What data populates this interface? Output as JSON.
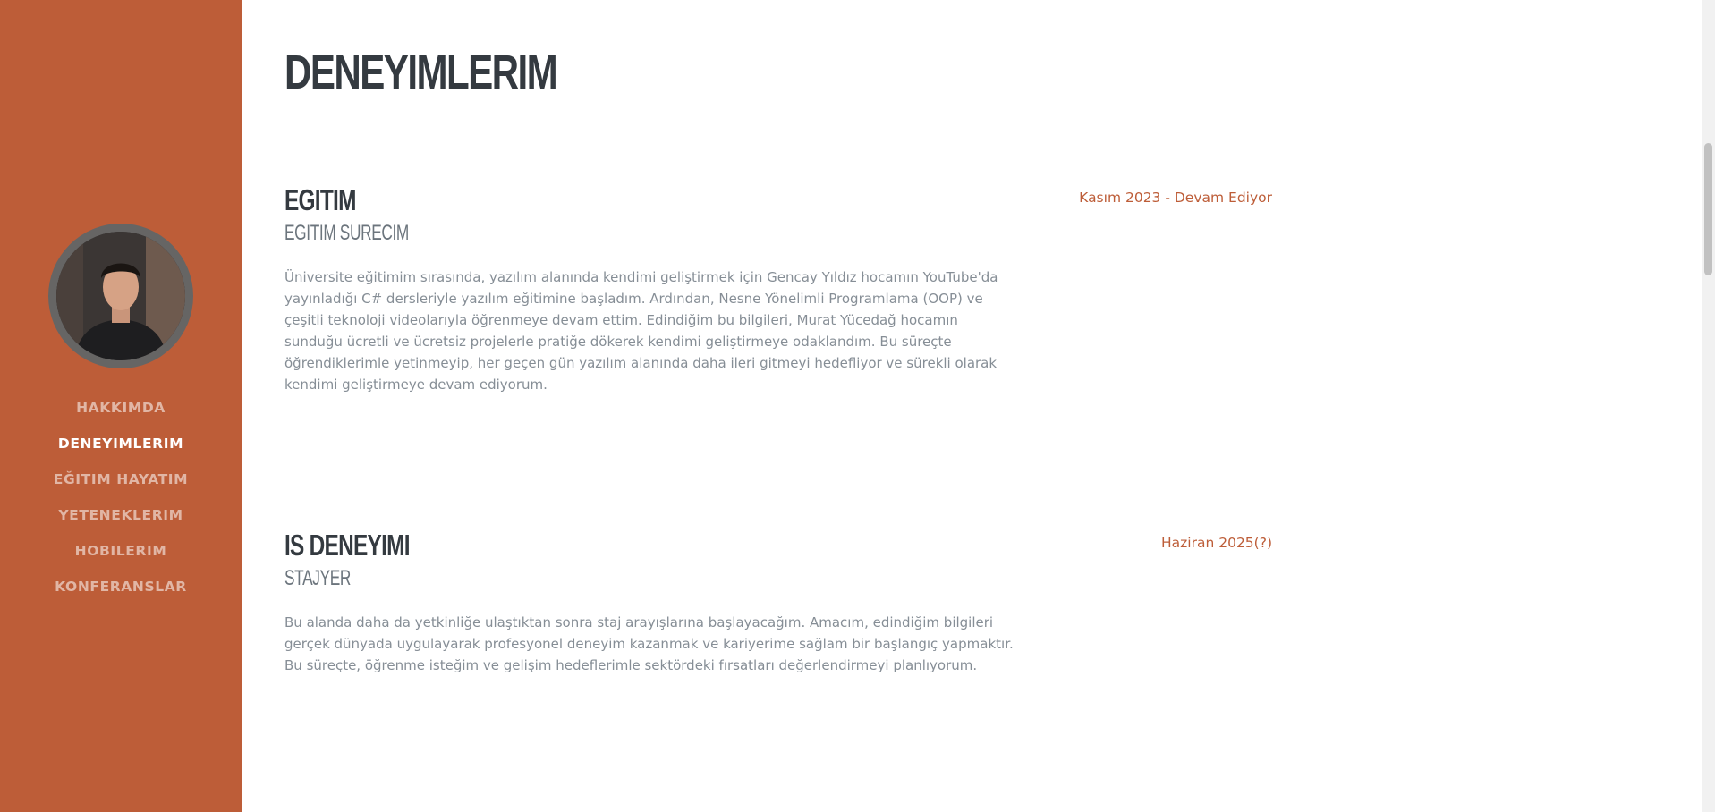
{
  "sidebar": {
    "avatar_alt": "Profile photo",
    "nav": [
      {
        "label": "HAKKIMDA",
        "active": false
      },
      {
        "label": "DENEYIMLERIM",
        "active": true
      },
      {
        "label": "EĞITIM HAYATIM",
        "active": false
      },
      {
        "label": "YETENEKLERIM",
        "active": false
      },
      {
        "label": "HOBILERIM",
        "active": false
      },
      {
        "label": "KONFERANSLAR",
        "active": false
      }
    ]
  },
  "main": {
    "title": "DENEYIMLERIM",
    "sections": [
      {
        "heading": "EGITIM",
        "subheading": "EGITIM SURECIM",
        "date": "Kasım 2023 - Devam Ediyor",
        "body": "Üniversite eğitimim sırasında, yazılım alanında kendimi geliştirmek için Gencay Yıldız hocamın YouTube'da yayınladığı C# dersleriyle yazılım eğitimine başladım. Ardından, Nesne Yönelimli Programlama (OOP) ve çeşitli teknoloji videolarıyla öğrenmeye devam ettim. Edindiğim bu bilgileri, Murat Yücedağ hocamın sunduğu ücretli ve ücretsiz projelerle pratiğe dökerek kendimi geliştirmeye odaklandım. Bu süreçte öğrendiklerimle yetinmeyip, her geçen gün yazılım alanında daha ileri gitmeyi hedefliyor ve sürekli olarak kendimi geliştirmeye devam ediyorum."
      },
      {
        "heading": "IS DENEYIMI",
        "subheading": "STAJYER",
        "date": "Haziran 2025(?)",
        "body": "Bu alanda daha da yetkinliğe ulaştıktan sonra staj arayışlarına başlayacağım. Amacım, edindiğim bilgileri gerçek dünyada uygulayarak profesyonel deneyim kazanmak ve kariyerime sağlam bir başlangıç yapmaktır. Bu süreçte, öğrenme isteğim ve gelişim hedeflerimle sektördeki fırsatları değerlendirmeyi planlıyorum."
      }
    ]
  },
  "colors": {
    "accent": "#bd5d38",
    "heading": "#343a40",
    "muted": "#868e96"
  }
}
